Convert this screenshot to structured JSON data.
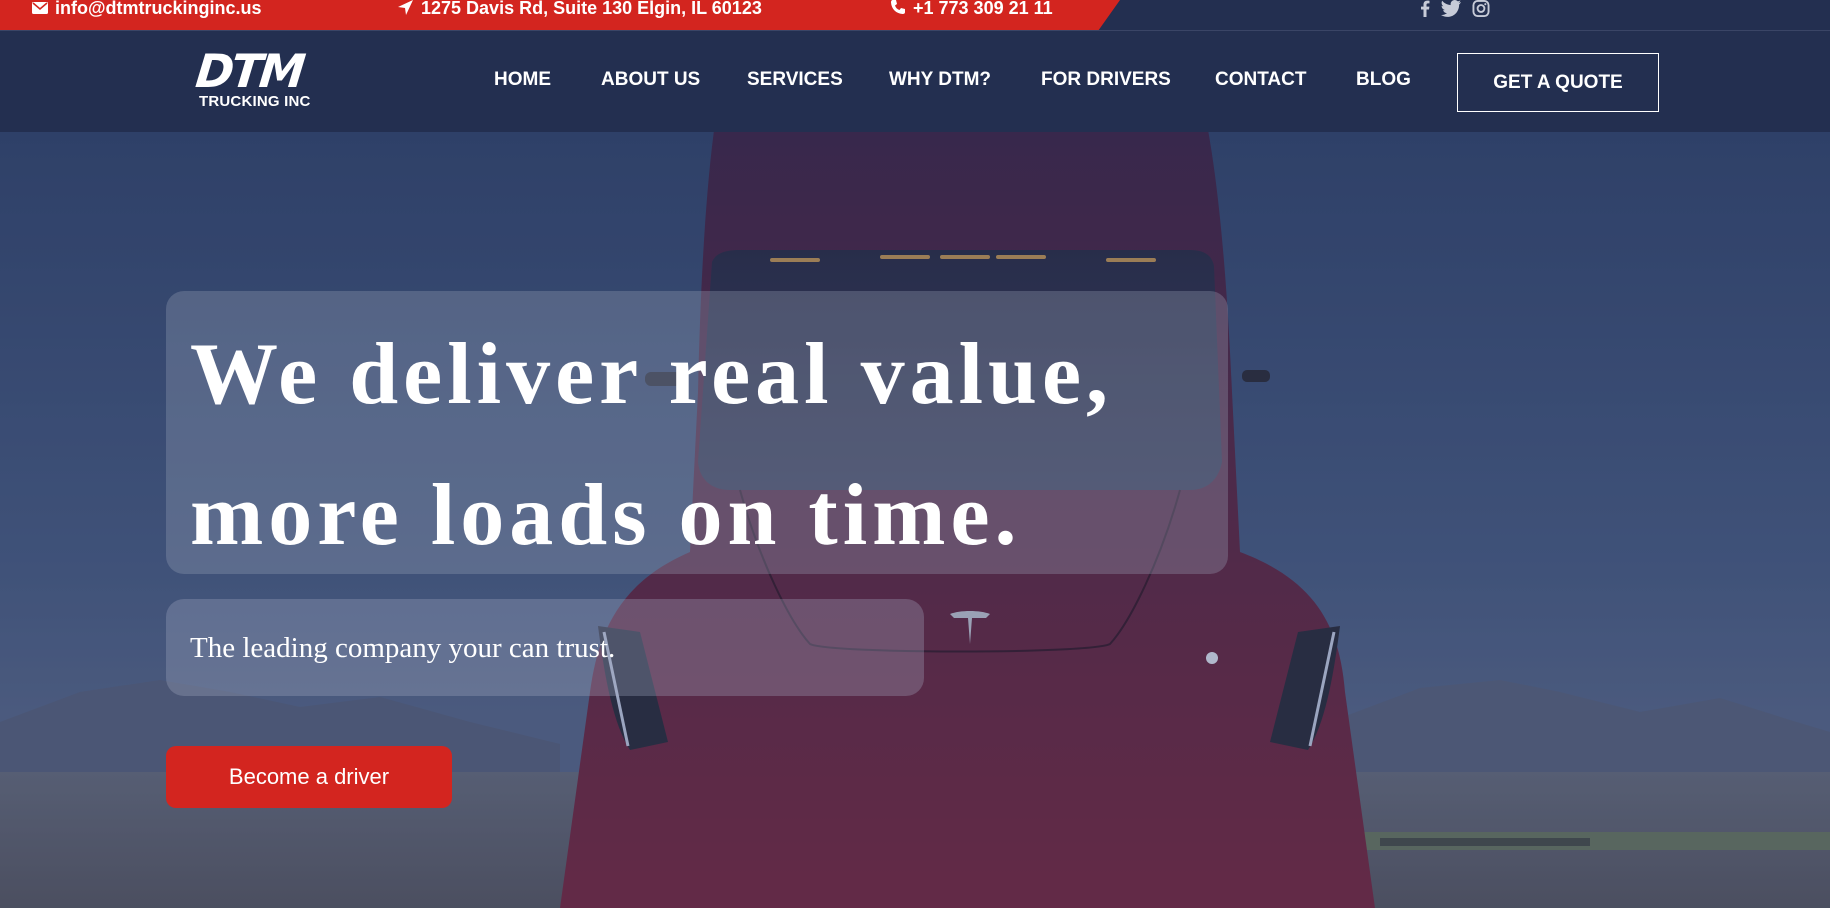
{
  "topbar": {
    "email": "info@dtmtruckinginc.us",
    "address": "1275 Davis Rd, Suite 130 Elgin, IL 60123",
    "phone": "+1 773 309 21 11",
    "icons": [
      "envelope-icon",
      "location-arrow-icon",
      "phone-icon"
    ],
    "social": [
      "facebook-icon",
      "twitter-icon",
      "instagram-icon"
    ]
  },
  "logo": {
    "main": "DTM",
    "sub": "TRUCKING INC"
  },
  "nav": {
    "items": [
      {
        "label": "HOME"
      },
      {
        "label": "ABOUT US"
      },
      {
        "label": "SERVICES"
      },
      {
        "label": "WHY DTM?"
      },
      {
        "label": "FOR DRIVERS"
      },
      {
        "label": "CONTACT"
      },
      {
        "label": "BLOG"
      }
    ],
    "cta": "GET A QUOTE"
  },
  "hero": {
    "headline_line1": "We deliver real value,",
    "headline_line2": "more loads on time.",
    "tagline": "The leading company your can trust.",
    "button": "Become a driver"
  },
  "colors": {
    "brand_red": "#d3251f",
    "navy": "#232f50",
    "white": "#ffffff"
  }
}
